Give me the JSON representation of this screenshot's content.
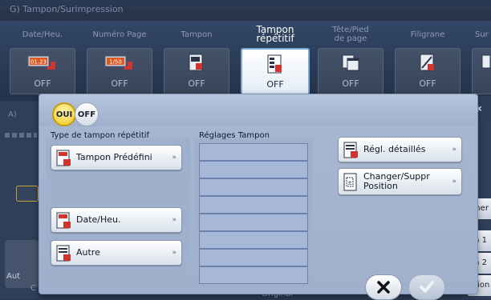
{
  "window_title": "G)  Tampon/Surimpression",
  "tabs": [
    {
      "label": "Date/Heu.",
      "value": "OFF",
      "icon": "date-stamp-icon"
    },
    {
      "label": "Numéro Page",
      "value": "OFF",
      "icon": "page-number-icon"
    },
    {
      "label": "Tampon",
      "value": "OFF",
      "icon": "stamp-icon"
    },
    {
      "label": "Tampon répétitif",
      "value": "OFF",
      "icon": "repeat-stamp-icon",
      "active": true
    },
    {
      "label": "Tête/Pied de page",
      "value": "OFF",
      "icon": "header-footer-icon"
    },
    {
      "label": "Filigrane",
      "value": "OFF",
      "icon": "watermark-icon"
    },
    {
      "label": "Sur",
      "value": "",
      "icon": "overlay-icon"
    }
  ],
  "background": {
    "section_a": "A)",
    "aut_label": "Aut",
    "c_label": "C",
    "original_label": "Original",
    "right_buttons": [
      "rmer",
      "on 1",
      "on 2",
      "ation"
    ]
  },
  "dialog": {
    "toggle_on": "OUI",
    "toggle_off": "OFF",
    "type_label": "Type de tampon répétitif",
    "settings_label": "Réglages Tampon",
    "buttons": {
      "predefined": "Tampon Prédéfini",
      "date": "Date/Heu.",
      "other": "Autre",
      "detail": "Régl. détaillés",
      "position": "Changer/Suppr Position"
    },
    "settings_rows": 9
  },
  "colors": {
    "accent_yellow": "#f3c61c",
    "dialog_bg": "#a8b8d3",
    "stamp_red": "#d0342c"
  }
}
